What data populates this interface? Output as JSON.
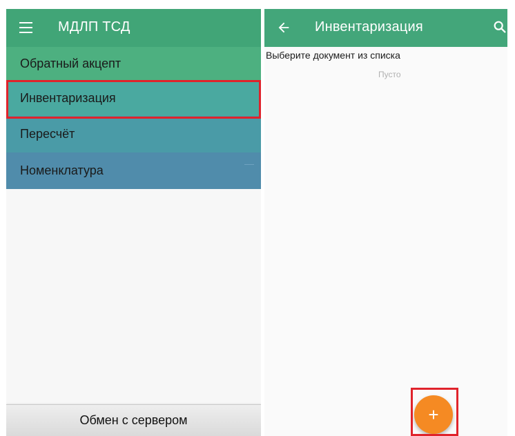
{
  "left_screen": {
    "appbar": {
      "title": "МДЛП ТСД",
      "menu_icon": "hamburger-menu-icon"
    },
    "menu_items": [
      {
        "label": "Обратный акцепт"
      },
      {
        "label": "Инвентаризация",
        "highlighted": true
      },
      {
        "label": "Пересчёт"
      },
      {
        "label": "Номенклатура"
      }
    ],
    "bottom_button": {
      "label": "Обмен с сервером"
    }
  },
  "right_screen": {
    "appbar": {
      "title": "Инвентаризация",
      "back_icon": "arrow-left-icon",
      "search_icon": "search-icon"
    },
    "prompt": "Выберите документ из списка",
    "empty_text": "Пусто",
    "fab": {
      "symbol": "+",
      "icon": "add-icon",
      "highlighted": true,
      "color": "#f58a23"
    }
  },
  "colors": {
    "appbar_green": "#41a577",
    "highlight_red": "#e0232b"
  }
}
